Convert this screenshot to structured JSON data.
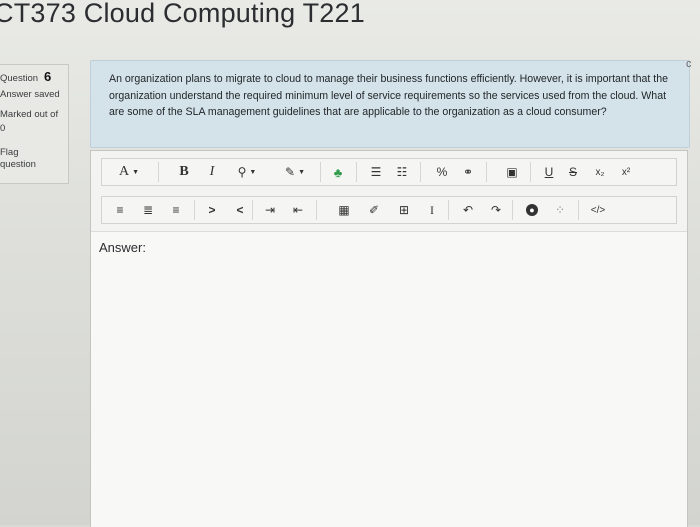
{
  "course": {
    "title": "CT373 Cloud Computing T221"
  },
  "question_info": {
    "label": "Question",
    "number": "6",
    "status": "Answer saved",
    "marked_out_of_label": "Marked out of",
    "marks": "0",
    "flag_label": "Flag",
    "edit_label": "question"
  },
  "question": {
    "text": "An organization plans to migrate to cloud to manage their business functions efficiently. However, it is important that the organization understand the required minimum level of service requirements so the services used from the cloud. What are some of the SLA management guidelines that are applicable to the organization as a cloud consumer?"
  },
  "toolbar": {
    "row1": [
      {
        "name": "font-size-button",
        "glyph": "A",
        "caret": true
      },
      {
        "name": "bold-button",
        "glyph": "B"
      },
      {
        "name": "italic-button",
        "glyph": "I"
      },
      {
        "name": "text-color-button",
        "glyph": "⚲",
        "caret": true
      },
      {
        "name": "highlight-button",
        "glyph": "✎",
        "caret": true
      },
      {
        "name": "styles-button",
        "glyph": "♣"
      },
      {
        "name": "unordered-list-button",
        "glyph": "☰"
      },
      {
        "name": "ordered-list-button",
        "glyph": "☷"
      },
      {
        "name": "link-button",
        "glyph": "%"
      },
      {
        "name": "unlink-button",
        "glyph": "⚭"
      },
      {
        "name": "image-button",
        "glyph": "▣"
      },
      {
        "name": "underline-button",
        "glyph": "U"
      },
      {
        "name": "strikethrough-button",
        "glyph": "S"
      },
      {
        "name": "subscript-button",
        "glyph": "x₂"
      },
      {
        "name": "superscript-button",
        "glyph": "x²"
      }
    ],
    "row2": [
      {
        "name": "align-left-button",
        "glyph": "≡"
      },
      {
        "name": "align-center-button",
        "glyph": "≣"
      },
      {
        "name": "align-right-button",
        "glyph": "≡"
      },
      {
        "name": "ltr-button",
        "glyph": ">"
      },
      {
        "name": "rtl-button",
        "glyph": "<"
      },
      {
        "name": "indent-button",
        "glyph": "⇥"
      },
      {
        "name": "outdent-button",
        "glyph": "⇤"
      },
      {
        "name": "equation-button",
        "glyph": "▦"
      },
      {
        "name": "edit-button",
        "glyph": "✐"
      },
      {
        "name": "table-button",
        "glyph": "⊞"
      },
      {
        "name": "clear-format-button",
        "glyph": "I"
      },
      {
        "name": "undo-button",
        "glyph": "↶"
      },
      {
        "name": "redo-button",
        "glyph": "↷"
      },
      {
        "name": "accessibility-button",
        "glyph": "●"
      },
      {
        "name": "screenreader-button",
        "glyph": "⁘"
      },
      {
        "name": "html-button",
        "glyph": "</>"
      }
    ]
  },
  "answer": {
    "label": "Answer:",
    "value": ""
  }
}
